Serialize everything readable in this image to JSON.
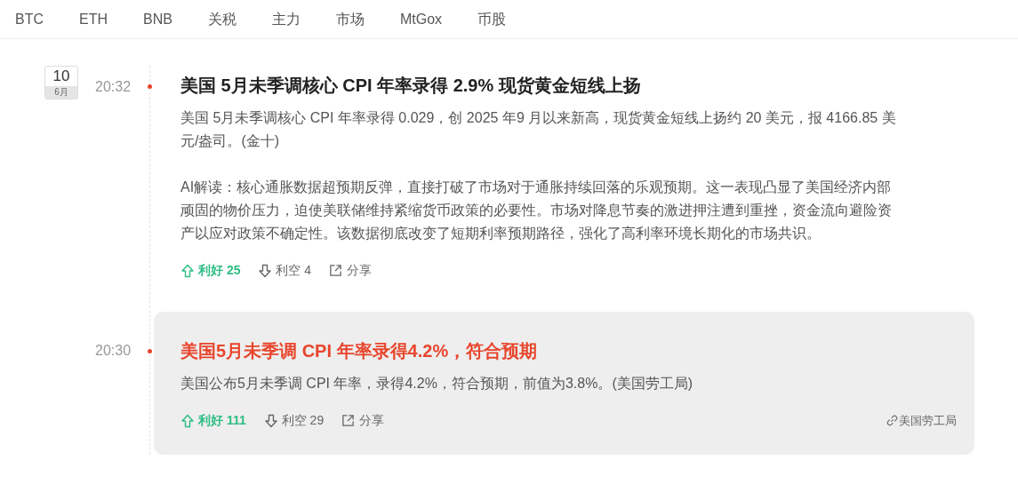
{
  "tabs": [
    "BTC",
    "ETH",
    "BNB",
    "关税",
    "主力",
    "市场",
    "MtGox",
    "币股"
  ],
  "news": [
    {
      "date": {
        "day": "10",
        "month": "6月"
      },
      "time": "20:32",
      "highlighted": false,
      "title": "美国 5月未季调核心 CPI 年率录得 2.9% 现货黄金短线上扬",
      "paragraphs": [
        "美国 5月未季调核心 CPI 年率录得 0.029，创 2025 年9 月以来新高，现货黄金短线上扬约 20 美元，报 4166.85 美元/盎司。(金十)",
        "AI解读：核心通胀数据超预期反弹，直接打破了市场对于通胀持续回落的乐观预期。这一表现凸显了美国经济内部顽固的物价压力，迫使美联储维持紧缩货币政策的必要性。市场对降息节奏的激进押注遭到重挫，资金流向避险资产以应对政策不确定性。该数据彻底改变了短期利率预期路径，强化了高利率环境长期化的市场共识。"
      ],
      "bullish": "利好 25",
      "bearish": "利空 4",
      "share": "分享"
    },
    {
      "time": "20:30",
      "highlighted": true,
      "title": "美国5月未季调 CPI 年率录得4.2%，符合预期",
      "paragraphs": [
        "美国公布5月未季调 CPI 年率，录得4.2%，符合预期，前值为3.8%。(美国劳工局)"
      ],
      "bullish": "利好 111",
      "bearish": "利空 29",
      "share": "分享",
      "source": "美国劳工局"
    }
  ]
}
